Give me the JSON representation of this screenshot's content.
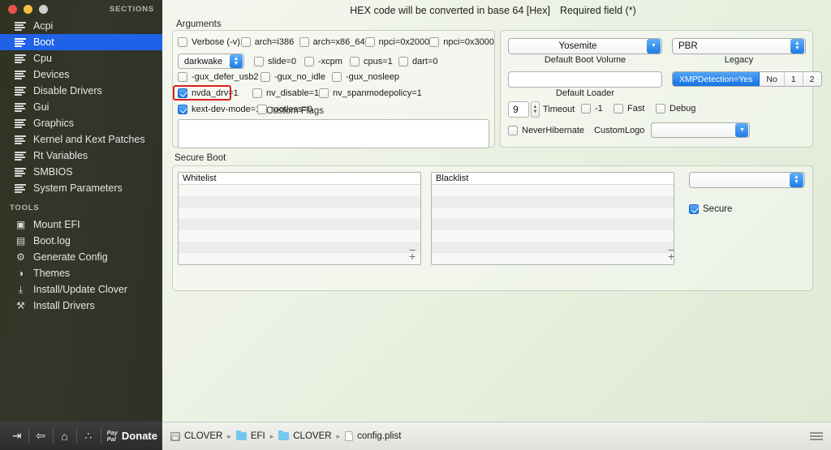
{
  "window": {
    "sections_label": "SECTIONS",
    "tools_label": "TOOLS"
  },
  "sidebar": {
    "sections": [
      {
        "label": "Acpi",
        "icon": "list-icon",
        "selected": false
      },
      {
        "label": "Boot",
        "icon": "list-icon",
        "selected": true
      },
      {
        "label": "Cpu",
        "icon": "list-icon",
        "selected": false
      },
      {
        "label": "Devices",
        "icon": "list-icon",
        "selected": false
      },
      {
        "label": "Disable Drivers",
        "icon": "list-icon",
        "selected": false
      },
      {
        "label": "Gui",
        "icon": "list-icon",
        "selected": false
      },
      {
        "label": "Graphics",
        "icon": "list-icon",
        "selected": false
      },
      {
        "label": "Kernel and Kext Patches",
        "icon": "list-icon",
        "selected": false
      },
      {
        "label": "Rt Variables",
        "icon": "list-icon",
        "selected": false
      },
      {
        "label": "SMBIOS",
        "icon": "list-icon",
        "selected": false
      },
      {
        "label": "System Parameters",
        "icon": "list-icon",
        "selected": false
      }
    ],
    "tools": [
      {
        "label": "Mount EFI",
        "icon": "disk-mount-icon",
        "glyph": "▣"
      },
      {
        "label": "Boot.log",
        "icon": "document-icon",
        "glyph": "▤"
      },
      {
        "label": "Generate Config",
        "icon": "gear-icon",
        "glyph": "⚙"
      },
      {
        "label": "Themes",
        "icon": "palette-icon",
        "glyph": "◑"
      },
      {
        "label": "Install/Update Clover",
        "icon": "download-icon",
        "glyph": "⤓"
      },
      {
        "label": "Install Drivers",
        "icon": "tools-icon",
        "glyph": "⚒"
      }
    ]
  },
  "header": {
    "hex_note": "HEX code will be converted in base 64 [Hex]",
    "required_note": "Required field (*)"
  },
  "arguments": {
    "title": "Arguments",
    "row1": [
      {
        "label": "Verbose (-v)",
        "checked": false
      },
      {
        "label": "arch=i386",
        "checked": false
      },
      {
        "label": "arch=x86_64",
        "checked": false
      },
      {
        "label": "npci=0x2000",
        "checked": false
      },
      {
        "label": "npci=0x3000",
        "checked": false
      }
    ],
    "darkwake_value": "darkwake",
    "row2": [
      {
        "label": "slide=0",
        "checked": false
      },
      {
        "label": "-xcpm",
        "checked": false
      },
      {
        "label": "cpus=1",
        "checked": false
      },
      {
        "label": "dart=0",
        "checked": false
      }
    ],
    "row3": [
      {
        "label": "-gux_defer_usb2",
        "checked": false
      },
      {
        "label": "-gux_no_idle",
        "checked": false
      },
      {
        "label": "-gux_nosleep",
        "checked": false
      }
    ],
    "row4": [
      {
        "label": "nvda_drv=1",
        "checked": true,
        "highlighted": true
      },
      {
        "label": "nv_disable=1",
        "checked": false
      },
      {
        "label": "nv_spanmodepolicy=1",
        "checked": false
      }
    ],
    "row5": [
      {
        "label": "kext-dev-mode=1",
        "checked": true
      },
      {
        "label": "rootless=0",
        "checked": false
      }
    ],
    "custom_flags_label": "Custom Flags",
    "custom_flags_value": ""
  },
  "boot_options": {
    "default_boot_volume_value": "Yosemite",
    "default_boot_volume_label": "Default Boot Volume",
    "legacy_value": "PBR",
    "legacy_label": "Legacy",
    "default_loader_value": "",
    "default_loader_label": "Default Loader",
    "xmp_segments": [
      {
        "label": "XMPDetection=Yes",
        "active": true
      },
      {
        "label": "No",
        "active": false
      },
      {
        "label": "1",
        "active": false
      },
      {
        "label": "2",
        "active": false
      }
    ],
    "timeout_value": "9",
    "timeout_label": "Timeout",
    "minus_one_label": "-1",
    "minus_one_checked": false,
    "fast_label": "Fast",
    "fast_checked": false,
    "debug_label": "Debug",
    "debug_checked": false,
    "never_hibernate_label": "NeverHibernate",
    "never_hibernate_checked": false,
    "custom_logo_label": "CustomLogo",
    "custom_logo_value": ""
  },
  "secure_boot": {
    "title": "Secure Boot",
    "whitelist_header": "Whitelist",
    "whitelist_items": [],
    "blacklist_header": "Blacklist",
    "blacklist_items": [],
    "policy_value": "",
    "secure_label": "Secure",
    "secure_checked": true,
    "add_glyph": "+",
    "remove_glyph": "−"
  },
  "toolbar": {
    "buttons": [
      {
        "name": "import-button",
        "glyph": "⇥"
      },
      {
        "name": "export-button",
        "glyph": "⇦"
      },
      {
        "name": "home-button",
        "glyph": "⌂"
      },
      {
        "name": "share-button",
        "glyph": "∴"
      }
    ],
    "paypal_line1": "Pay",
    "paypal_line2": "Pal",
    "donate_label": "Donate"
  },
  "path_bar": {
    "crumbs": [
      {
        "label": "CLOVER",
        "icon": "disk-icon"
      },
      {
        "label": "EFI",
        "icon": "folder-icon"
      },
      {
        "label": "CLOVER",
        "icon": "folder-icon"
      },
      {
        "label": "config.plist",
        "icon": "file-icon"
      }
    ],
    "separator": "▸"
  },
  "colors": {
    "accent_blue": "#1f62e8",
    "highlight_red": "#d9211a",
    "control_blue": "#1d7ce6"
  }
}
